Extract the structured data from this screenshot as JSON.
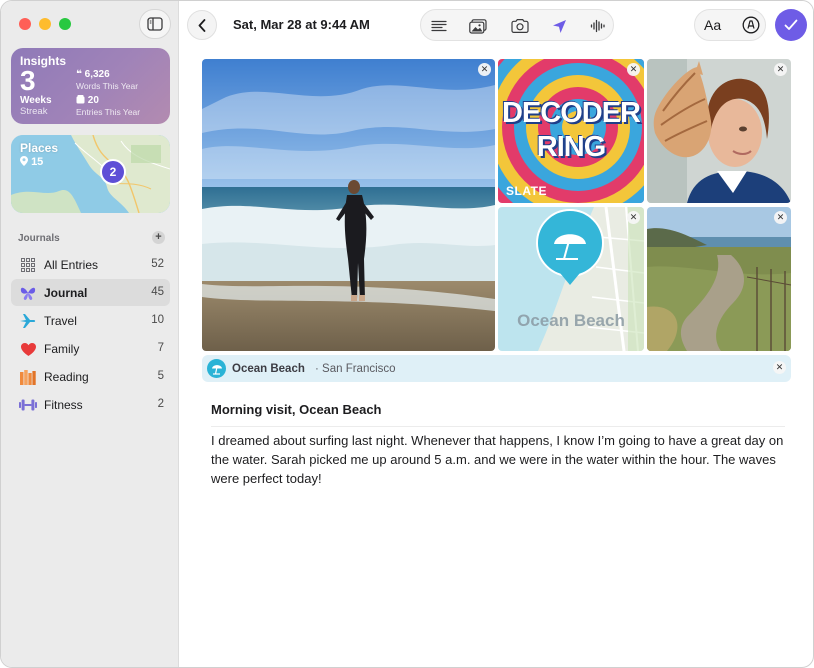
{
  "window": {
    "sidebar_toggle_icon": "sidebar-icon"
  },
  "insights": {
    "title": "Insights",
    "streak_value": "3",
    "streak_unit": "Weeks",
    "streak_label": "Streak",
    "words_value": "6,326",
    "words_label": "Words This Year",
    "entries_value": "20",
    "entries_label": "Entries This Year",
    "colors": {
      "from": "#8f7ab8",
      "to": "#b38bb0"
    }
  },
  "places": {
    "title": "Places",
    "count": "15",
    "map_cluster": "2"
  },
  "journals": {
    "heading": "Journals",
    "add_icon": "plus-icon",
    "items": [
      {
        "label": "All Entries",
        "count": "52",
        "icon": "grid-icon",
        "color": "#6e6e73",
        "active": false
      },
      {
        "label": "Journal",
        "count": "45",
        "icon": "butterfly-icon",
        "color": "#6b5ce7",
        "active": true
      },
      {
        "label": "Travel",
        "count": "10",
        "icon": "airplane-icon",
        "color": "#2aa8d8",
        "active": false
      },
      {
        "label": "Family",
        "count": "7",
        "icon": "heart-icon",
        "color": "#e83a3a",
        "active": false
      },
      {
        "label": "Reading",
        "count": "5",
        "icon": "books-icon",
        "color": "#f08a3c",
        "active": false
      },
      {
        "label": "Fitness",
        "count": "2",
        "icon": "dumbbell-icon",
        "color": "#7a6fd6",
        "active": false
      }
    ]
  },
  "toolbar": {
    "back_icon": "chevron-left-icon",
    "date": "Sat, Mar 28 at 9:44 AM",
    "tools": [
      "suggestions-icon",
      "photo-library-icon",
      "camera-icon",
      "location-icon",
      "audio-icon"
    ],
    "font_label": "Aa",
    "markup_icon": "markup-icon",
    "done_icon": "checkmark-icon",
    "accent": "#6e5ce6"
  },
  "media": {
    "podcast_title_line1": "DECODER",
    "podcast_title_line2": "RING",
    "podcast_publisher": "SLATE",
    "map_tile_label": "Ocean Beach"
  },
  "location": {
    "name": "Ocean Beach",
    "separator": "·",
    "city": "San Francisco"
  },
  "entry": {
    "title": "Morning visit, Ocean Beach",
    "body": "I dreamed about surfing last night. Whenever that happens, I know I’m going to have a great day on the water. Sarah picked me up around 5 a.m. and we were in the water within the hour. The waves were perfect today!"
  }
}
